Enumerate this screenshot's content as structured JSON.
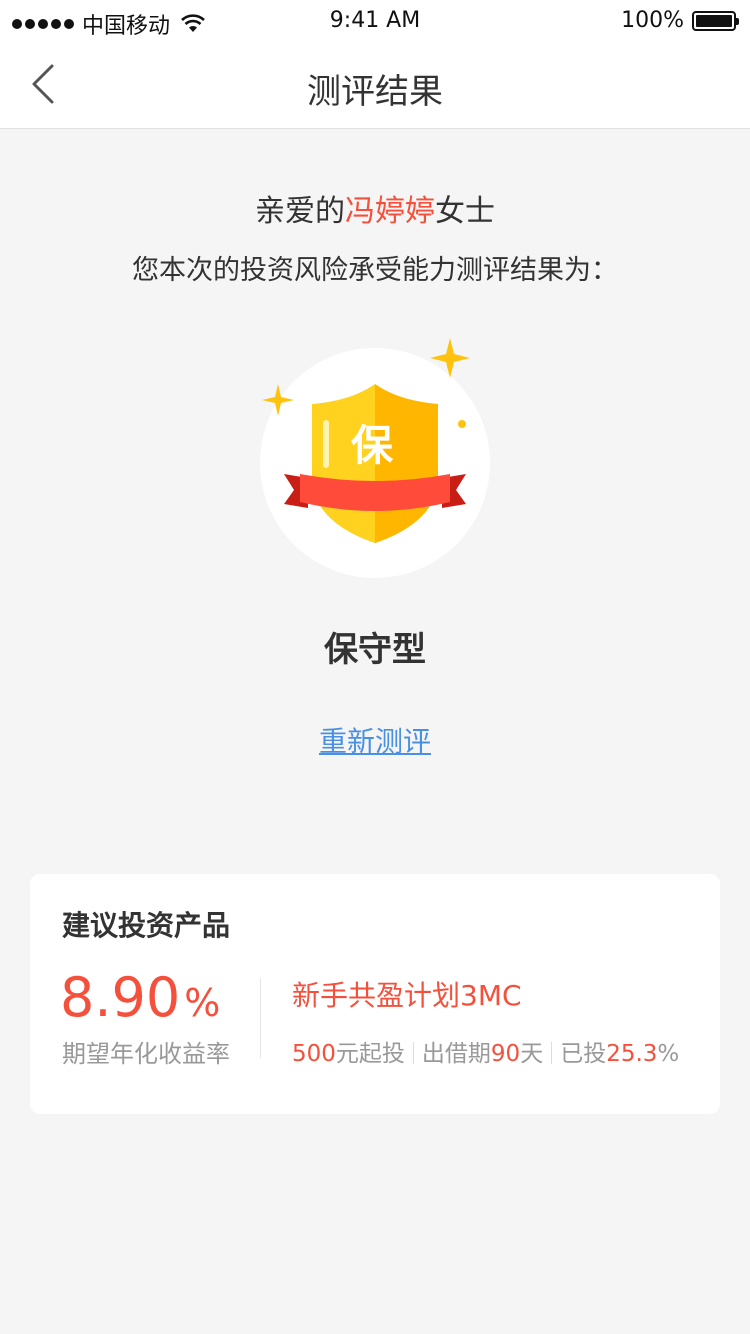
{
  "status_bar": {
    "carrier": "中国移动",
    "time": "9:41 AM",
    "battery": "100%"
  },
  "nav": {
    "title": "测评结果",
    "back_icon": "chevron-left-icon"
  },
  "greeting": {
    "prefix": "亲爱的",
    "name": "冯婷婷",
    "suffix": "女士",
    "intro": "您本次的投资风险承受能力测评结果为："
  },
  "result": {
    "badge_char": "保",
    "type": "保守型",
    "retest_label": "重新测评"
  },
  "card": {
    "title": "建议投资产品",
    "rate_value": "8.90",
    "rate_unit": "%",
    "rate_label": "期望年化收益率",
    "product_name": "新手共盈计划3MC",
    "min_amount": "500",
    "min_amount_suffix": "元起投",
    "period_prefix": "出借期",
    "period_value": "90",
    "period_suffix": "天",
    "invested_prefix": "已投",
    "invested_value": "25.3",
    "invested_unit": "%"
  },
  "colors": {
    "accent": "#f5503c",
    "link": "#4a90e2",
    "shield_gold": "#ffc20e",
    "ribbon_red": "#ff4b3a"
  }
}
